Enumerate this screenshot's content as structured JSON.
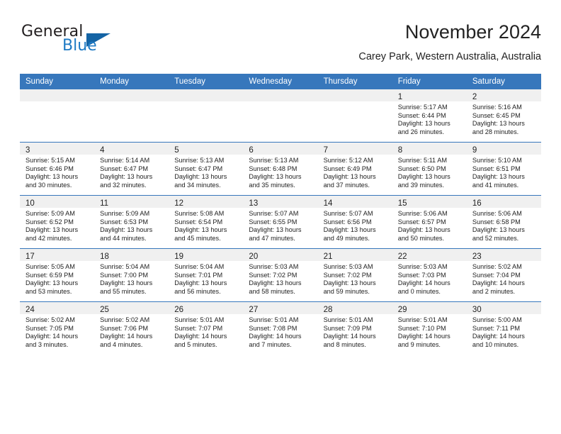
{
  "brand": {
    "name_part1": "General",
    "name_part2": "Blue",
    "triangle_color": "#1464a5",
    "blue_color": "#1e7ac4"
  },
  "header": {
    "title": "November 2024",
    "subtitle": "Carey Park, Western Australia, Australia"
  },
  "theme": {
    "header_bg": "#3777bc",
    "daynum_bg": "#f0f0f0",
    "row_rule": "#3777bc",
    "text": "#222222"
  },
  "weekday_headers": [
    "Sunday",
    "Monday",
    "Tuesday",
    "Wednesday",
    "Thursday",
    "Friday",
    "Saturday"
  ],
  "weeks": [
    [
      {
        "day": "",
        "sunrise": "",
        "sunset": "",
        "daylight1": "",
        "daylight2": "",
        "empty": true
      },
      {
        "day": "",
        "sunrise": "",
        "sunset": "",
        "daylight1": "",
        "daylight2": "",
        "empty": true
      },
      {
        "day": "",
        "sunrise": "",
        "sunset": "",
        "daylight1": "",
        "daylight2": "",
        "empty": true
      },
      {
        "day": "",
        "sunrise": "",
        "sunset": "",
        "daylight1": "",
        "daylight2": "",
        "empty": true
      },
      {
        "day": "",
        "sunrise": "",
        "sunset": "",
        "daylight1": "",
        "daylight2": "",
        "empty": true
      },
      {
        "day": "1",
        "sunrise": "Sunrise: 5:17 AM",
        "sunset": "Sunset: 6:44 PM",
        "daylight1": "Daylight: 13 hours",
        "daylight2": "and 26 minutes."
      },
      {
        "day": "2",
        "sunrise": "Sunrise: 5:16 AM",
        "sunset": "Sunset: 6:45 PM",
        "daylight1": "Daylight: 13 hours",
        "daylight2": "and 28 minutes."
      }
    ],
    [
      {
        "day": "3",
        "sunrise": "Sunrise: 5:15 AM",
        "sunset": "Sunset: 6:46 PM",
        "daylight1": "Daylight: 13 hours",
        "daylight2": "and 30 minutes."
      },
      {
        "day": "4",
        "sunrise": "Sunrise: 5:14 AM",
        "sunset": "Sunset: 6:47 PM",
        "daylight1": "Daylight: 13 hours",
        "daylight2": "and 32 minutes."
      },
      {
        "day": "5",
        "sunrise": "Sunrise: 5:13 AM",
        "sunset": "Sunset: 6:47 PM",
        "daylight1": "Daylight: 13 hours",
        "daylight2": "and 34 minutes."
      },
      {
        "day": "6",
        "sunrise": "Sunrise: 5:13 AM",
        "sunset": "Sunset: 6:48 PM",
        "daylight1": "Daylight: 13 hours",
        "daylight2": "and 35 minutes."
      },
      {
        "day": "7",
        "sunrise": "Sunrise: 5:12 AM",
        "sunset": "Sunset: 6:49 PM",
        "daylight1": "Daylight: 13 hours",
        "daylight2": "and 37 minutes."
      },
      {
        "day": "8",
        "sunrise": "Sunrise: 5:11 AM",
        "sunset": "Sunset: 6:50 PM",
        "daylight1": "Daylight: 13 hours",
        "daylight2": "and 39 minutes."
      },
      {
        "day": "9",
        "sunrise": "Sunrise: 5:10 AM",
        "sunset": "Sunset: 6:51 PM",
        "daylight1": "Daylight: 13 hours",
        "daylight2": "and 41 minutes."
      }
    ],
    [
      {
        "day": "10",
        "sunrise": "Sunrise: 5:09 AM",
        "sunset": "Sunset: 6:52 PM",
        "daylight1": "Daylight: 13 hours",
        "daylight2": "and 42 minutes."
      },
      {
        "day": "11",
        "sunrise": "Sunrise: 5:09 AM",
        "sunset": "Sunset: 6:53 PM",
        "daylight1": "Daylight: 13 hours",
        "daylight2": "and 44 minutes."
      },
      {
        "day": "12",
        "sunrise": "Sunrise: 5:08 AM",
        "sunset": "Sunset: 6:54 PM",
        "daylight1": "Daylight: 13 hours",
        "daylight2": "and 45 minutes."
      },
      {
        "day": "13",
        "sunrise": "Sunrise: 5:07 AM",
        "sunset": "Sunset: 6:55 PM",
        "daylight1": "Daylight: 13 hours",
        "daylight2": "and 47 minutes."
      },
      {
        "day": "14",
        "sunrise": "Sunrise: 5:07 AM",
        "sunset": "Sunset: 6:56 PM",
        "daylight1": "Daylight: 13 hours",
        "daylight2": "and 49 minutes."
      },
      {
        "day": "15",
        "sunrise": "Sunrise: 5:06 AM",
        "sunset": "Sunset: 6:57 PM",
        "daylight1": "Daylight: 13 hours",
        "daylight2": "and 50 minutes."
      },
      {
        "day": "16",
        "sunrise": "Sunrise: 5:06 AM",
        "sunset": "Sunset: 6:58 PM",
        "daylight1": "Daylight: 13 hours",
        "daylight2": "and 52 minutes."
      }
    ],
    [
      {
        "day": "17",
        "sunrise": "Sunrise: 5:05 AM",
        "sunset": "Sunset: 6:59 PM",
        "daylight1": "Daylight: 13 hours",
        "daylight2": "and 53 minutes."
      },
      {
        "day": "18",
        "sunrise": "Sunrise: 5:04 AM",
        "sunset": "Sunset: 7:00 PM",
        "daylight1": "Daylight: 13 hours",
        "daylight2": "and 55 minutes."
      },
      {
        "day": "19",
        "sunrise": "Sunrise: 5:04 AM",
        "sunset": "Sunset: 7:01 PM",
        "daylight1": "Daylight: 13 hours",
        "daylight2": "and 56 minutes."
      },
      {
        "day": "20",
        "sunrise": "Sunrise: 5:03 AM",
        "sunset": "Sunset: 7:02 PM",
        "daylight1": "Daylight: 13 hours",
        "daylight2": "and 58 minutes."
      },
      {
        "day": "21",
        "sunrise": "Sunrise: 5:03 AM",
        "sunset": "Sunset: 7:02 PM",
        "daylight1": "Daylight: 13 hours",
        "daylight2": "and 59 minutes."
      },
      {
        "day": "22",
        "sunrise": "Sunrise: 5:03 AM",
        "sunset": "Sunset: 7:03 PM",
        "daylight1": "Daylight: 14 hours",
        "daylight2": "and 0 minutes."
      },
      {
        "day": "23",
        "sunrise": "Sunrise: 5:02 AM",
        "sunset": "Sunset: 7:04 PM",
        "daylight1": "Daylight: 14 hours",
        "daylight2": "and 2 minutes."
      }
    ],
    [
      {
        "day": "24",
        "sunrise": "Sunrise: 5:02 AM",
        "sunset": "Sunset: 7:05 PM",
        "daylight1": "Daylight: 14 hours",
        "daylight2": "and 3 minutes."
      },
      {
        "day": "25",
        "sunrise": "Sunrise: 5:02 AM",
        "sunset": "Sunset: 7:06 PM",
        "daylight1": "Daylight: 14 hours",
        "daylight2": "and 4 minutes."
      },
      {
        "day": "26",
        "sunrise": "Sunrise: 5:01 AM",
        "sunset": "Sunset: 7:07 PM",
        "daylight1": "Daylight: 14 hours",
        "daylight2": "and 5 minutes."
      },
      {
        "day": "27",
        "sunrise": "Sunrise: 5:01 AM",
        "sunset": "Sunset: 7:08 PM",
        "daylight1": "Daylight: 14 hours",
        "daylight2": "and 7 minutes."
      },
      {
        "day": "28",
        "sunrise": "Sunrise: 5:01 AM",
        "sunset": "Sunset: 7:09 PM",
        "daylight1": "Daylight: 14 hours",
        "daylight2": "and 8 minutes."
      },
      {
        "day": "29",
        "sunrise": "Sunrise: 5:01 AM",
        "sunset": "Sunset: 7:10 PM",
        "daylight1": "Daylight: 14 hours",
        "daylight2": "and 9 minutes."
      },
      {
        "day": "30",
        "sunrise": "Sunrise: 5:00 AM",
        "sunset": "Sunset: 7:11 PM",
        "daylight1": "Daylight: 14 hours",
        "daylight2": "and 10 minutes."
      }
    ]
  ]
}
